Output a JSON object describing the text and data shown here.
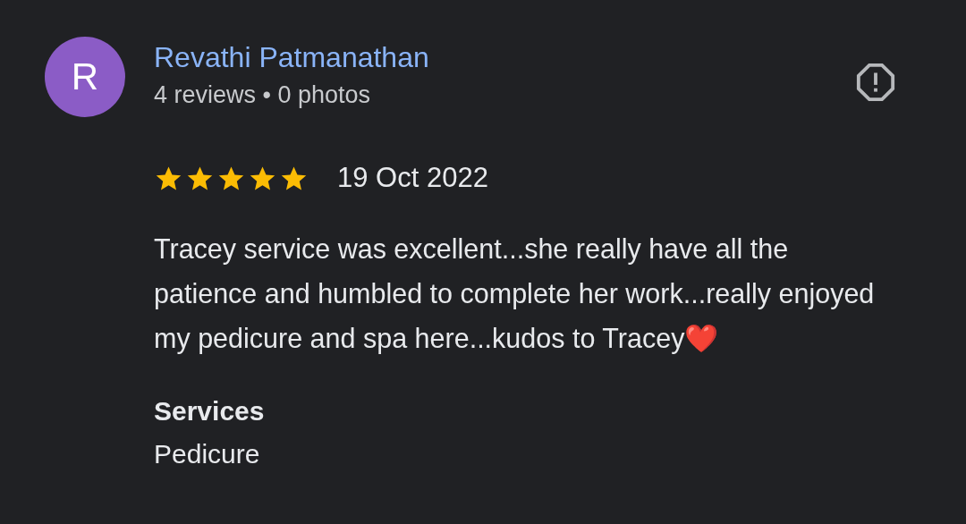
{
  "review": {
    "avatar_letter": "R",
    "author": "Revathi Patmanathan",
    "meta": "4 reviews • 0 photos",
    "stars": 5,
    "date": "19 Oct 2022",
    "text": "Tracey service was excellent...she really have all the patience and humbled to complete her work...really enjoyed my pedicure and spa here...kudos to Tracey❤️",
    "services_heading": "Services",
    "services_value": "Pedicure"
  }
}
